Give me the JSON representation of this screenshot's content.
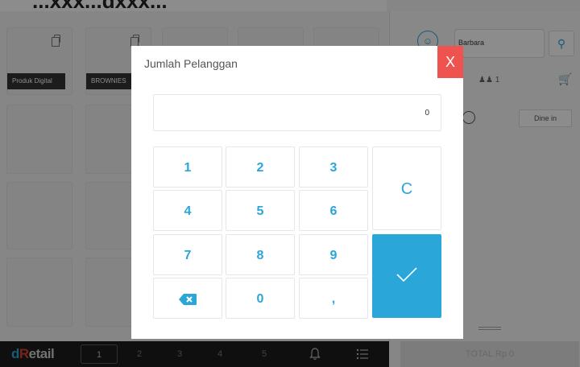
{
  "top_caption": "...xxx...dxxx...",
  "tiles": {
    "produk_digital_label": "Produk Digital",
    "brownies_label": "BROWNIES"
  },
  "panel": {
    "customer_name": "Barbara",
    "guest_count": "1",
    "order_type": "Dine in"
  },
  "bottombar": {
    "logo": {
      "c": "d",
      "r": "R",
      "rest": "etail"
    },
    "pages": [
      "1",
      "2",
      "3",
      "4",
      "5"
    ],
    "total": "TOTAL Rp 0"
  },
  "modal": {
    "title": "Jumlah Pelanggan",
    "close_label": "X",
    "display_value": "0",
    "keys": {
      "k1": "1",
      "k2": "2",
      "k3": "3",
      "k4": "4",
      "k5": "5",
      "k6": "6",
      "k7": "7",
      "k8": "8",
      "k9": "9",
      "k0": "0",
      "comma": ",",
      "clear": "C"
    }
  },
  "colors": {
    "accent": "#2aa6d9",
    "close_red": "#ef5350",
    "brand_red": "#e23d2f",
    "bottombar_bg": "#1c1c1c"
  },
  "icons": [
    "copy-icon",
    "user-icon",
    "guest-icon",
    "basket-icon",
    "bell-icon",
    "menu-icon",
    "backspace-icon",
    "check-icon",
    "close-icon"
  ]
}
